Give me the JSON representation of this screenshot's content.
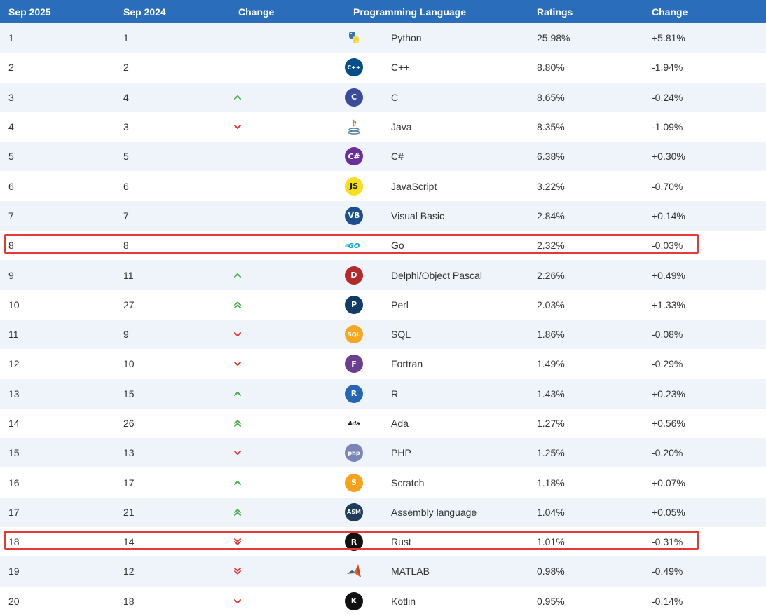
{
  "headers": [
    "Sep 2025",
    "Sep 2024",
    "Change",
    "Programming Language",
    "Ratings",
    "Change"
  ],
  "colors": {
    "header_bg": "#2a6ebb",
    "up": "#4caf50",
    "down": "#e53935",
    "highlight": "#e53935",
    "row_alt": "#eef4fa"
  },
  "rows": [
    {
      "rank": "1",
      "prev": "1",
      "trend": "none",
      "icon": "python-icon",
      "lang": "Python",
      "rating": "25.98%",
      "change": "+5.81%"
    },
    {
      "rank": "2",
      "prev": "2",
      "trend": "none",
      "icon": "cpp-icon",
      "lang": "C++",
      "rating": "8.80%",
      "change": "-1.94%"
    },
    {
      "rank": "3",
      "prev": "4",
      "trend": "up",
      "icon": "c-icon",
      "lang": "C",
      "rating": "8.65%",
      "change": "-0.24%"
    },
    {
      "rank": "4",
      "prev": "3",
      "trend": "down",
      "icon": "java-icon",
      "lang": "Java",
      "rating": "8.35%",
      "change": "-1.09%"
    },
    {
      "rank": "5",
      "prev": "5",
      "trend": "none",
      "icon": "csharp-icon",
      "lang": "C#",
      "rating": "6.38%",
      "change": "+0.30%"
    },
    {
      "rank": "6",
      "prev": "6",
      "trend": "none",
      "icon": "javascript-icon",
      "lang": "JavaScript",
      "rating": "3.22%",
      "change": "-0.70%"
    },
    {
      "rank": "7",
      "prev": "7",
      "trend": "none",
      "icon": "visual-basic-icon",
      "lang": "Visual Basic",
      "rating": "2.84%",
      "change": "+0.14%"
    },
    {
      "rank": "8",
      "prev": "8",
      "trend": "none",
      "icon": "go-icon",
      "lang": "Go",
      "rating": "2.32%",
      "change": "-0.03%",
      "highlight": true
    },
    {
      "rank": "9",
      "prev": "11",
      "trend": "up",
      "icon": "delphi-icon",
      "lang": "Delphi/Object Pascal",
      "rating": "2.26%",
      "change": "+0.49%"
    },
    {
      "rank": "10",
      "prev": "27",
      "trend": "upup",
      "icon": "perl-icon",
      "lang": "Perl",
      "rating": "2.03%",
      "change": "+1.33%"
    },
    {
      "rank": "11",
      "prev": "9",
      "trend": "down",
      "icon": "sql-icon",
      "lang": "SQL",
      "rating": "1.86%",
      "change": "-0.08%"
    },
    {
      "rank": "12",
      "prev": "10",
      "trend": "down",
      "icon": "fortran-icon",
      "lang": "Fortran",
      "rating": "1.49%",
      "change": "-0.29%"
    },
    {
      "rank": "13",
      "prev": "15",
      "trend": "up",
      "icon": "r-icon",
      "lang": "R",
      "rating": "1.43%",
      "change": "+0.23%"
    },
    {
      "rank": "14",
      "prev": "26",
      "trend": "upup",
      "icon": "ada-icon",
      "lang": "Ada",
      "rating": "1.27%",
      "change": "+0.56%"
    },
    {
      "rank": "15",
      "prev": "13",
      "trend": "down",
      "icon": "php-icon",
      "lang": "PHP",
      "rating": "1.25%",
      "change": "-0.20%"
    },
    {
      "rank": "16",
      "prev": "17",
      "trend": "up",
      "icon": "scratch-icon",
      "lang": "Scratch",
      "rating": "1.18%",
      "change": "+0.07%"
    },
    {
      "rank": "17",
      "prev": "21",
      "trend": "upup",
      "icon": "assembly-icon",
      "lang": "Assembly language",
      "rating": "1.04%",
      "change": "+0.05%"
    },
    {
      "rank": "18",
      "prev": "14",
      "trend": "downdown",
      "icon": "rust-icon",
      "lang": "Rust",
      "rating": "1.01%",
      "change": "-0.31%",
      "highlight": true
    },
    {
      "rank": "19",
      "prev": "12",
      "trend": "downdown",
      "icon": "matlab-icon",
      "lang": "MATLAB",
      "rating": "0.98%",
      "change": "-0.49%"
    },
    {
      "rank": "20",
      "prev": "18",
      "trend": "down",
      "icon": "kotlin-icon",
      "lang": "Kotlin",
      "rating": "0.95%",
      "change": "-0.14%"
    }
  ],
  "logos": {
    "cpp-icon": {
      "text": "C++",
      "bg": "#044f88"
    },
    "c-icon": {
      "text": "C",
      "bg": "#3a4a9c"
    },
    "csharp-icon": {
      "text": "C#",
      "bg": "#6a2f9a"
    },
    "javascript-icon": {
      "text": "JS",
      "bg": "#f7df1e",
      "fg": "#222"
    },
    "visual-basic-icon": {
      "text": "VB",
      "bg": "#1f4e8c"
    },
    "delphi-icon": {
      "text": "D",
      "bg": "#b22a2a"
    },
    "perl-icon": {
      "text": "P",
      "bg": "#0f3d63"
    },
    "sql-icon": {
      "text": "SQL",
      "bg": "#f5a623"
    },
    "fortran-icon": {
      "text": "F",
      "bg": "#6b3f8f"
    },
    "r-icon": {
      "text": "R",
      "bg": "#2466b4"
    },
    "ada-icon": {
      "text": "Ada",
      "bg": "transparent",
      "fg": "#111"
    },
    "php-icon": {
      "text": "php",
      "bg": "#7a86b8"
    },
    "scratch-icon": {
      "text": "S",
      "bg": "#f7a21b"
    },
    "assembly-icon": {
      "text": "ASM",
      "bg": "#1d3b5a"
    },
    "rust-icon": {
      "text": "R",
      "bg": "#111111"
    },
    "kotlin-icon": {
      "text": "K",
      "bg": "#111111"
    }
  }
}
